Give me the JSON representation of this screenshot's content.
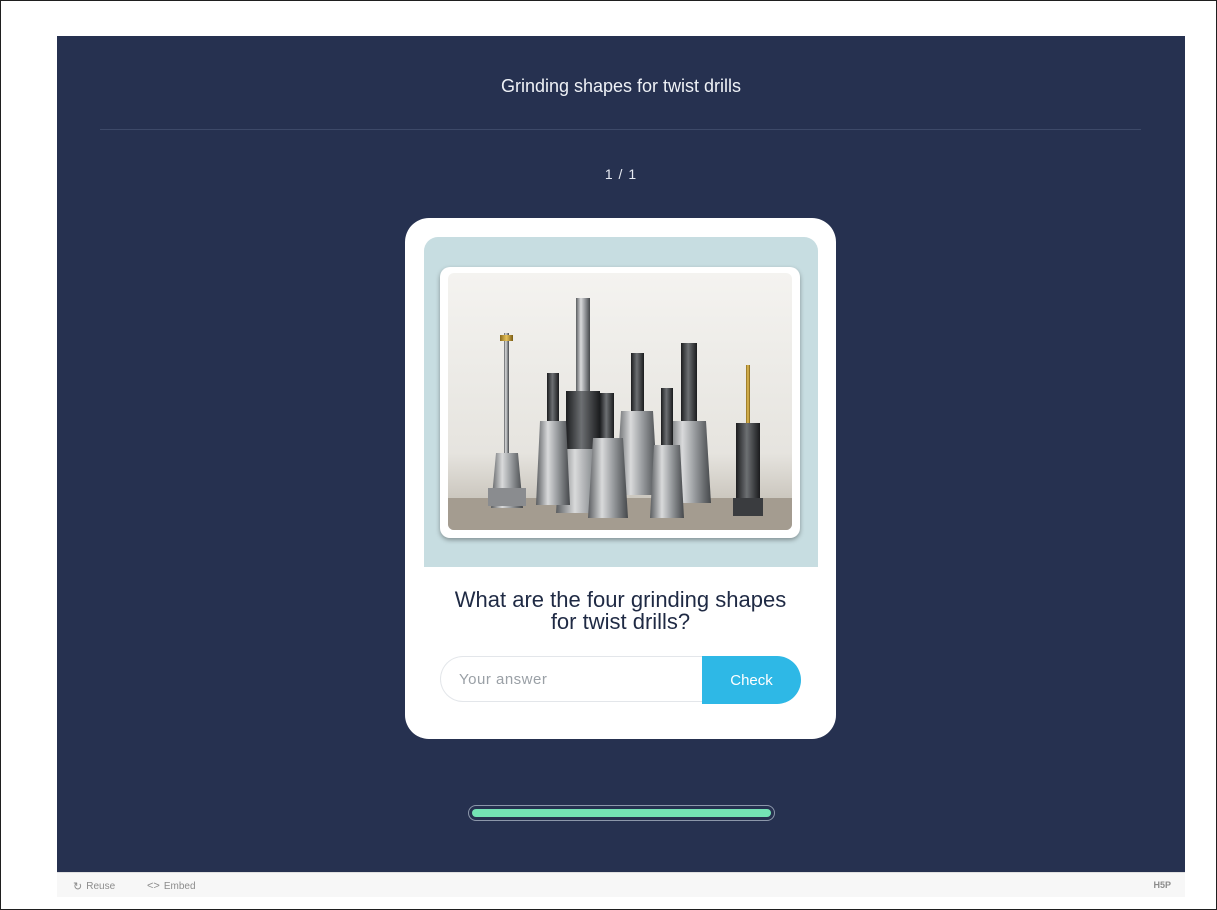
{
  "header": {
    "title": "Grinding shapes for twist drills",
    "counter": "1 / 1"
  },
  "card": {
    "image": {
      "icon": "milling-tools-photo",
      "alt": "Milling and drilling tools in holders"
    },
    "question": "What are the four grinding shapes for twist drills?",
    "answer": {
      "value": "",
      "placeholder": "Your answer"
    },
    "check_label": "Check"
  },
  "progress": {
    "fraction": 1.0
  },
  "footer": {
    "reuse_label": "Reuse",
    "reuse_icon": "refresh-icon",
    "embed_label": "Embed",
    "embed_icon": "code-icon",
    "logo_text": "H5P"
  },
  "colors": {
    "stage_bg": "#263150",
    "card_bg": "#ffffff",
    "image_area_bg": "#c7dde1",
    "check_button_bg": "#2eb8e6",
    "progress_fill": "#74e3b5"
  }
}
